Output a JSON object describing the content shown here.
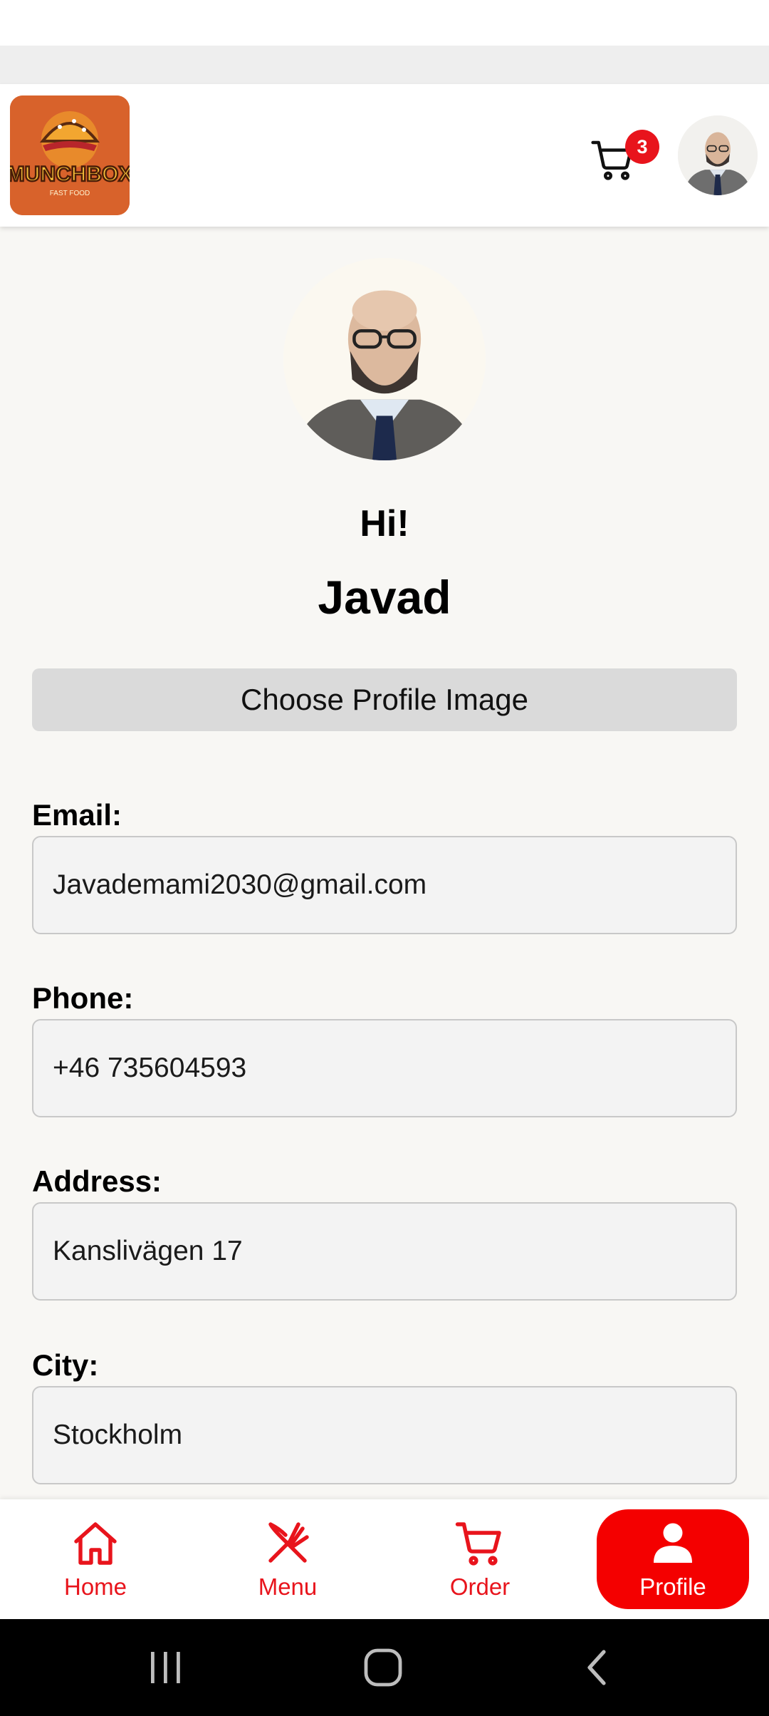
{
  "header": {
    "logo_text": "MUNCHBOX",
    "logo_subtext": "FAST FOOD",
    "cart_count": "3"
  },
  "profile": {
    "greeting": "Hi!",
    "name": "Javad",
    "choose_image_label": "Choose Profile Image"
  },
  "fields": {
    "email": {
      "label": "Email:",
      "value": "Javademami2030@gmail.com"
    },
    "phone": {
      "label": "Phone:",
      "value": "+46 735604593"
    },
    "address": {
      "label": "Address:",
      "value": "Kanslivägen 17"
    },
    "city": {
      "label": "City:",
      "value": "Stockholm"
    }
  },
  "bottom_nav": {
    "items": [
      {
        "label": "Home",
        "icon": "home-icon"
      },
      {
        "label": "Menu",
        "icon": "fork-knife-icon"
      },
      {
        "label": "Order",
        "icon": "cart-icon"
      },
      {
        "label": "Profile",
        "icon": "person-icon",
        "active": true
      }
    ]
  },
  "system_nav": {
    "icons": [
      "recent-apps-icon",
      "home-circle-icon",
      "back-icon"
    ]
  },
  "colors": {
    "accent": "#e8141c",
    "active_tab": "#f40000",
    "background": "#f8f7f4"
  }
}
